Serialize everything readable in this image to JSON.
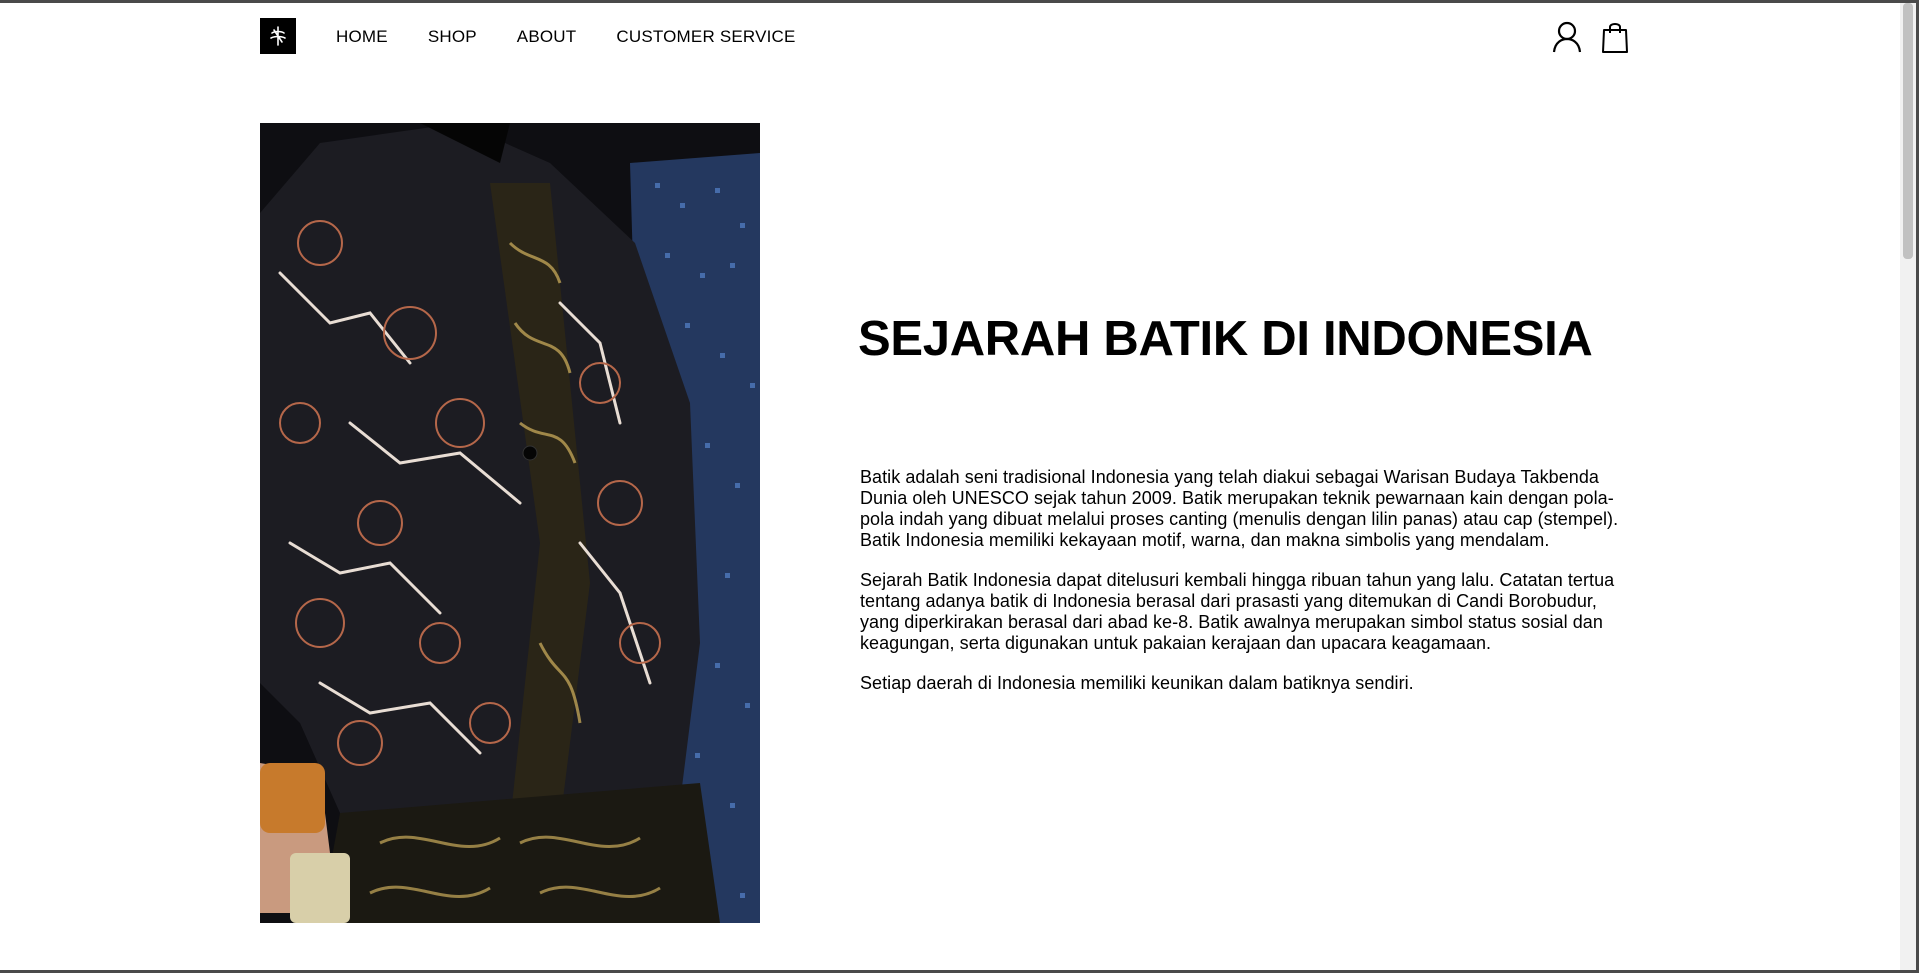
{
  "nav": {
    "items": [
      {
        "label": "HOME"
      },
      {
        "label": "SHOP"
      },
      {
        "label": "ABOUT"
      },
      {
        "label": "CUSTOMER SERVICE"
      }
    ]
  },
  "header_icons": [
    "user-icon",
    "shopping-bag-icon"
  ],
  "hero": {
    "title": "SEJARAH BATIK DI INDONESIA",
    "paragraphs": [
      "Batik adalah seni tradisional Indonesia yang telah diakui sebagai Warisan Budaya Takbenda Dunia oleh UNESCO sejak tahun 2009. Batik merupakan teknik pewarnaan kain dengan pola-pola indah yang dibuat melalui proses canting (menulis dengan lilin panas) atau cap (stempel). Batik Indonesia memiliki kekayaan motif, warna, dan makna simbolis yang mendalam.",
      "Sejarah Batik Indonesia dapat ditelusuri kembali hingga ribuan tahun yang lalu. Catatan tertua tentang adanya batik di Indonesia berasal dari prasasti yang ditemukan di Candi Borobudur, yang diperkirakan berasal dari abad ke-8. Batik awalnya merupakan simbol status sosial dan keagungan, serta digunakan untuk pakaian kerajaan dan upacara keagamaan.",
      "Setiap daerah di Indonesia memiliki keunikan dalam batiknya sendiri."
    ]
  },
  "colors": {
    "text": "#000000",
    "background": "#ffffff",
    "jacket": "#1c1c22",
    "motif_copper": "#b5674a",
    "motif_gold": "#b59a52",
    "dress_blue": "#2f4f8a"
  }
}
